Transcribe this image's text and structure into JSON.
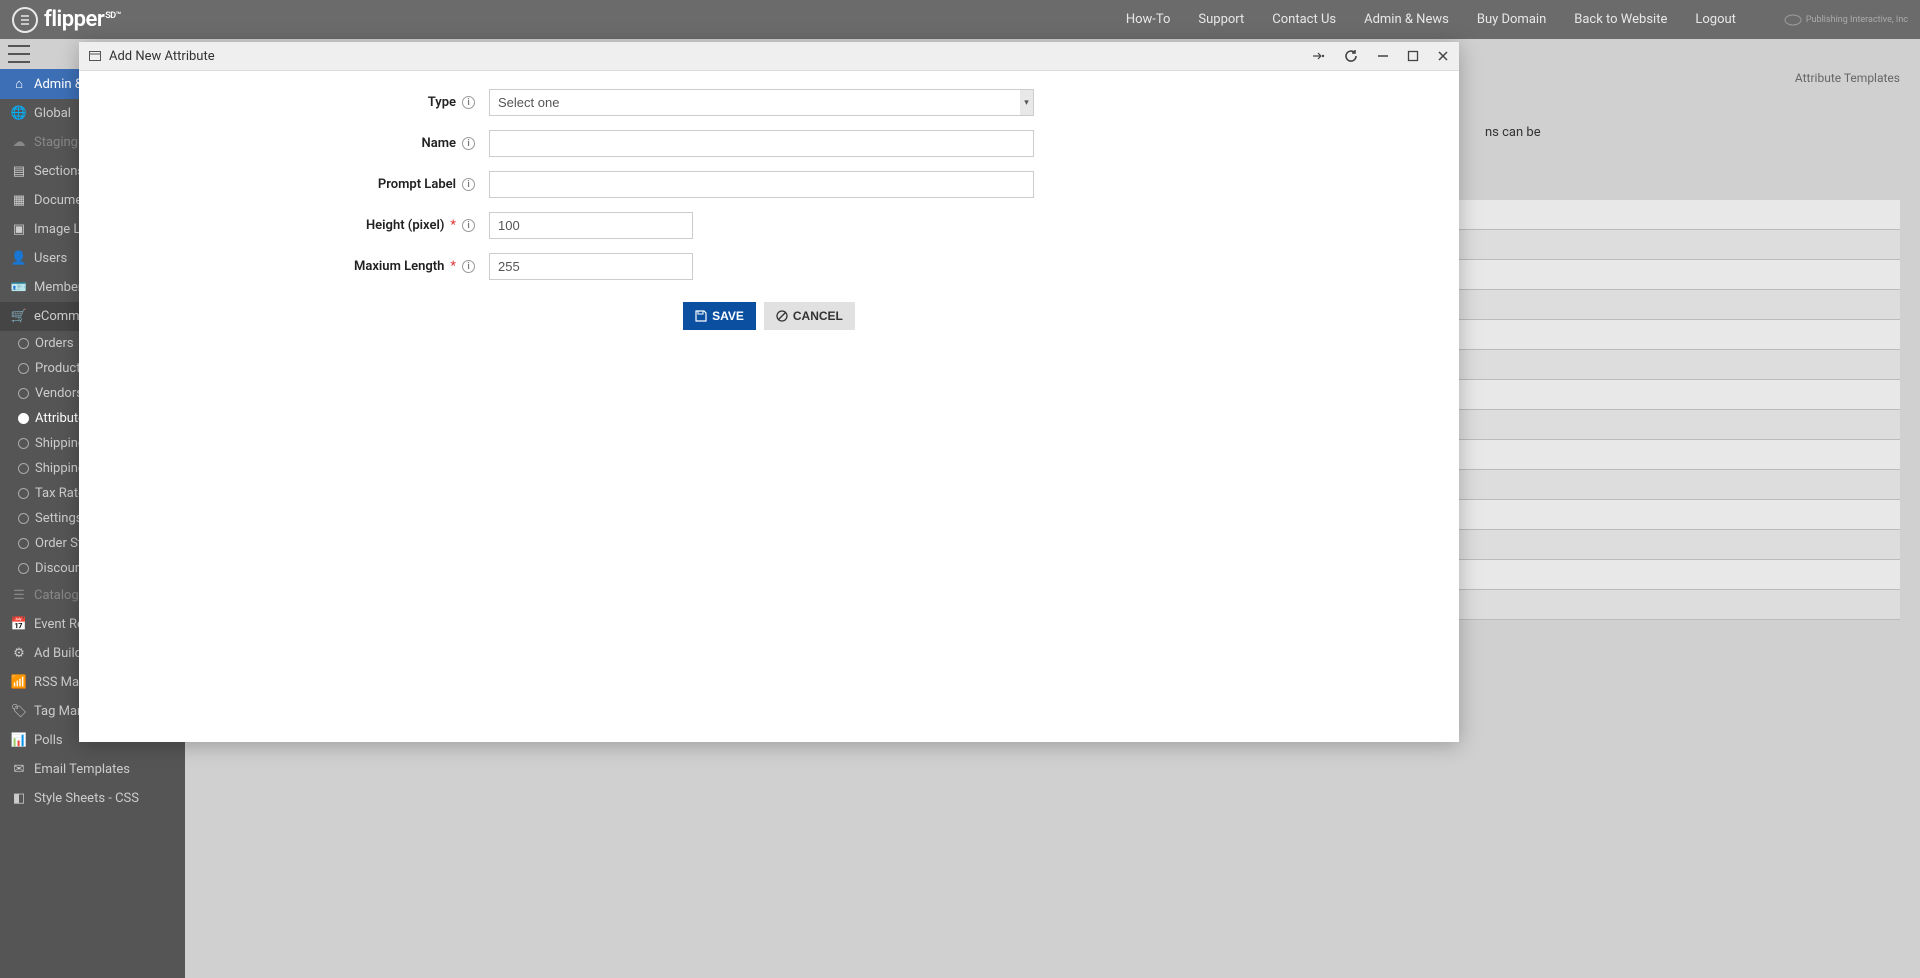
{
  "branding": {
    "name": "flipper",
    "suffix": "SD™"
  },
  "topnav": {
    "howto": "How-To",
    "support": "Support",
    "contact": "Contact Us",
    "adminnews": "Admin & News",
    "buydomain": "Buy Domain",
    "back": "Back to Website",
    "logout": "Logout",
    "partner": "Publishing Interactive, Inc"
  },
  "sidebar": {
    "adminews": "Admin & News",
    "global": "Global",
    "staging": "Staging",
    "sections": "Sections",
    "documents": "Documents",
    "imagelib": "Image Library",
    "users": "Users",
    "memberships": "Memberships",
    "ecommerce": "eCommerce",
    "sub": {
      "orders": "Orders",
      "products": "Products",
      "vendors": "Vendors",
      "attribute": "Attribute Templates",
      "shipping1": "Shipping",
      "shipping2": "Shipping",
      "taxrates": "Tax Rates",
      "settings": "Settings",
      "orderstatus": "Order Status",
      "discount": "Discount"
    },
    "catalog": "Catalog",
    "eventreg": "Event Registration",
    "adbuilder": "Ad Builder",
    "rssmanager": "RSS Manager",
    "tagmanager": "Tag Manager",
    "polls": "Polls",
    "emailtemplates": "Email Templates",
    "stylesheets": "Style Sheets - CSS"
  },
  "behind": {
    "tab_right": "Attribute Templates",
    "partial_text": "ns can be"
  },
  "modal": {
    "title": "Add New Attribute",
    "labels": {
      "type": "Type",
      "name": "Name",
      "prompt": "Prompt Label",
      "height": "Height (pixel)",
      "maxlen": "Maxium Length"
    },
    "values": {
      "type_placeholder": "Select one",
      "name": "",
      "prompt": "",
      "height": "100",
      "maxlen": "255"
    },
    "buttons": {
      "save": "SAVE",
      "cancel": "CANCEL"
    }
  }
}
